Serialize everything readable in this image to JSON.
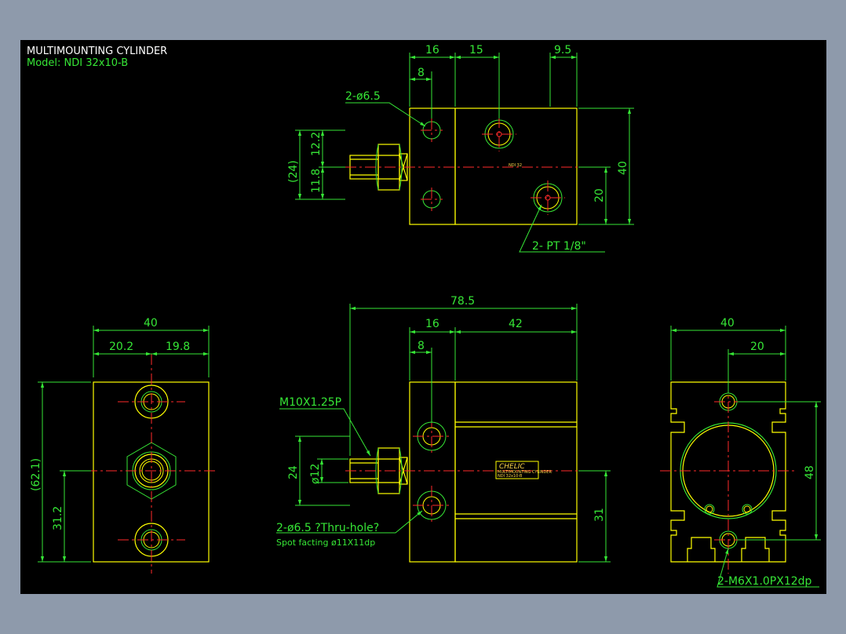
{
  "header": {
    "title": "MULTIMOUNTING CYLINDER",
    "model": "Model: NDI 32x10-B"
  },
  "colors": {
    "background": "#000000",
    "frame": "#8e9aab",
    "part_outline": "#ffff00",
    "dimension": "#36e636",
    "centerline": "#ff2a2a",
    "text_header": "#ffffff"
  },
  "top_view": {
    "dims": {
      "d16": "16",
      "d15": "15",
      "d9_5": "9.5",
      "d8": "8",
      "d12_2": "12.2",
      "d11_8": "11.8",
      "d24_ref": "(24)",
      "d40": "40",
      "d20": "20"
    },
    "labels": {
      "holes": "2-ø6.5",
      "ports": "2- PT 1/8\"",
      "model_mark": "NDI 32"
    }
  },
  "left_view": {
    "dims": {
      "d40": "40",
      "d20_2": "20.2",
      "d19_8": "19.8",
      "d62_1": "(62.1)",
      "d31_2": "31.2"
    }
  },
  "front_view": {
    "dims": {
      "d78_5": "78.5",
      "d16": "16",
      "d42": "42",
      "d8": "8",
      "d24": "24",
      "d12": "ø12",
      "d31": "31"
    },
    "labels": {
      "thread": "M10X1.25P",
      "holes": "2-ø6.5 ?Thru-hole?",
      "spot": "Spot facting  ø11X11dp",
      "brand": "CHELIC",
      "plate_line1": "MULTIMOUNTING CYLINDER",
      "plate_line2": "NDI 32x10-B"
    }
  },
  "right_view": {
    "dims": {
      "d40": "40",
      "d20": "20",
      "d48": "48"
    },
    "labels": {
      "taps": "2-M6X1.0PX12dp"
    }
  }
}
